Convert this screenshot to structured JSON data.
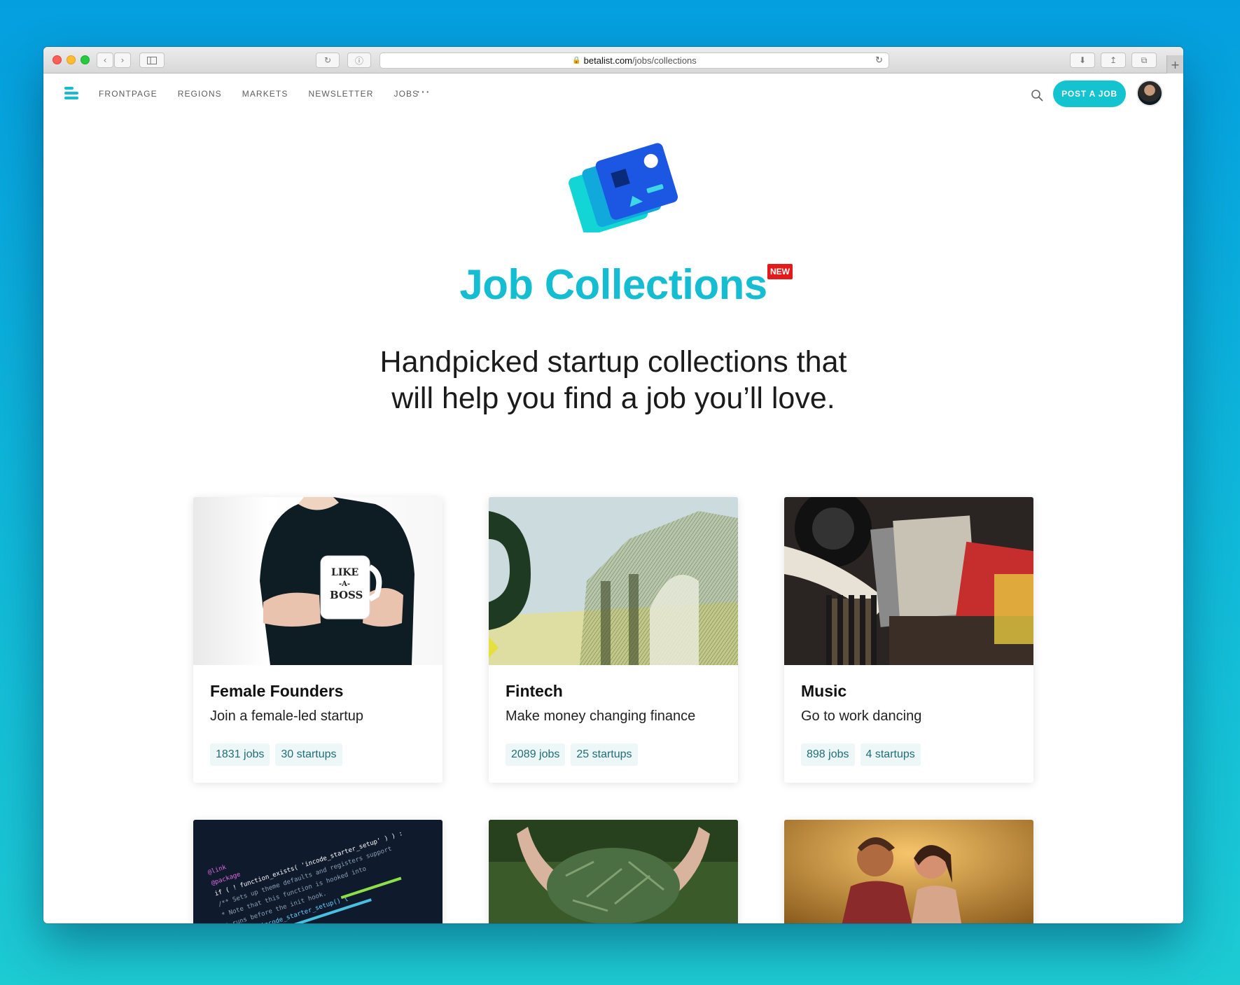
{
  "browser": {
    "url_domain": "betalist.com",
    "url_path": "/jobs/collections"
  },
  "nav": {
    "links": [
      "FRONTPAGE",
      "REGIONS",
      "MARKETS",
      "NEWSLETTER",
      "JOBS"
    ],
    "more": "···",
    "post_button": "POST A JOB"
  },
  "hero": {
    "title": "Job Collections",
    "badge": "NEW",
    "subtitle_line1": "Handpicked startup collections that",
    "subtitle_line2": "will help you find a job you’ll love."
  },
  "collections": [
    {
      "title": "Female Founders",
      "description": "Join a female-led startup",
      "jobs": "1831 jobs",
      "startups": "30 startups",
      "image": "woman-holding-mug"
    },
    {
      "title": "Fintech",
      "description": "Make money changing finance",
      "jobs": "2089 jobs",
      "startups": "25 startups",
      "image": "banknote-detail"
    },
    {
      "title": "Music",
      "description": "Go to work dancing",
      "jobs": "898 jobs",
      "startups": "4 startups",
      "image": "vinyl-records"
    },
    {
      "image": "code-on-screen"
    },
    {
      "image": "hands-holding-pine-needles"
    },
    {
      "image": "couple-in-field"
    }
  ],
  "colors": {
    "accent": "#14bdd2",
    "badge": "#e41a1a",
    "tag_bg": "#eef7f7",
    "tag_text": "#1f6d78"
  },
  "icons": [
    "menu-icon",
    "search-icon",
    "collections-logo-icon",
    "back-icon",
    "forward-icon",
    "sidebar-icon",
    "reload-icon",
    "share-icon",
    "download-icon",
    "tabs-icon"
  ]
}
